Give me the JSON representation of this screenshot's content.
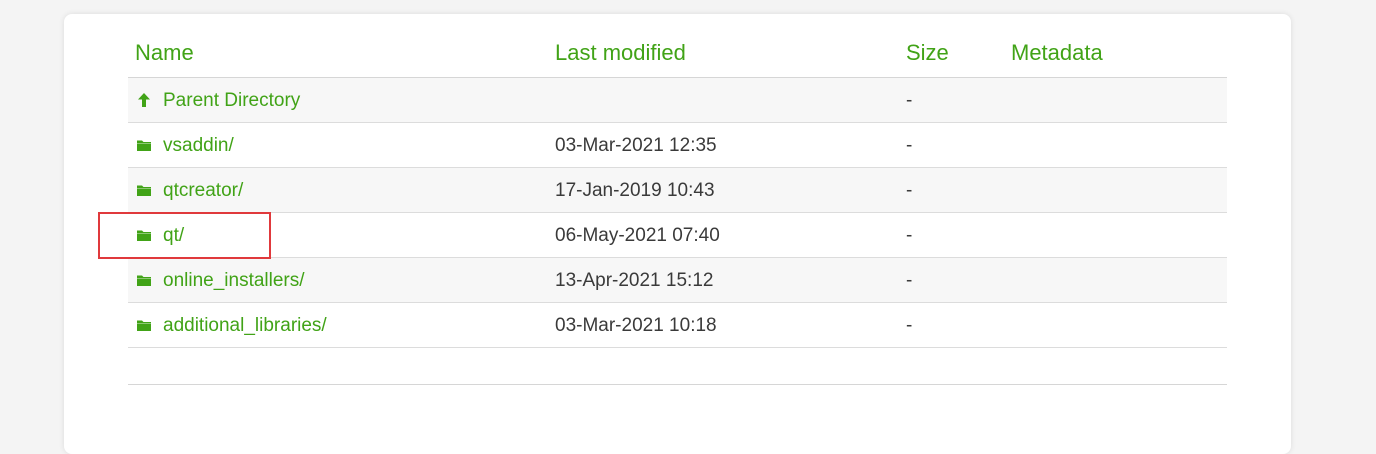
{
  "columns": {
    "name": "Name",
    "last_modified": "Last modified",
    "size": "Size",
    "metadata": "Metadata"
  },
  "rows": [
    {
      "name": "Parent Directory",
      "modified": "",
      "size": "-",
      "icon": "arrow-up-icon"
    },
    {
      "name": "vsaddin/",
      "modified": "03-Mar-2021 12:35",
      "size": "-",
      "icon": "folder-icon"
    },
    {
      "name": "qtcreator/",
      "modified": "17-Jan-2019 10:43",
      "size": "-",
      "icon": "folder-icon"
    },
    {
      "name": "qt/",
      "modified": "06-May-2021 07:40",
      "size": "-",
      "icon": "folder-icon"
    },
    {
      "name": "online_installers/",
      "modified": "13-Apr-2021 15:12",
      "size": "-",
      "icon": "folder-icon"
    },
    {
      "name": "additional_libraries/",
      "modified": "03-Mar-2021 10:18",
      "size": "-",
      "icon": "folder-icon"
    }
  ],
  "colors": {
    "link": "#41a317",
    "text": "#3a3a3a",
    "highlight": "#e0393c"
  }
}
